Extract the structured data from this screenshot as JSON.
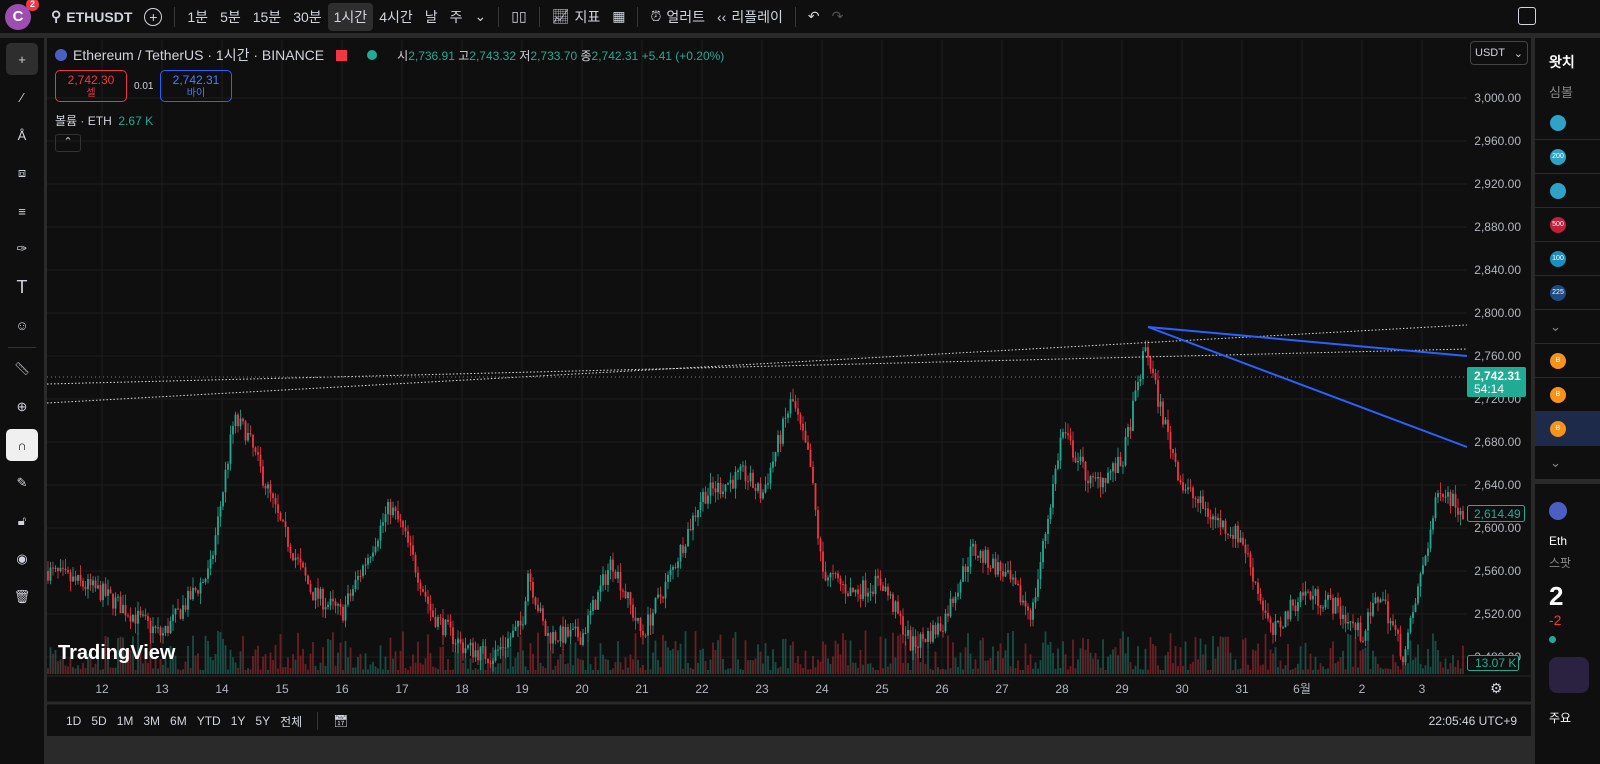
{
  "topbar": {
    "avatar_letter": "C",
    "notif_count": "2",
    "symbol": "ETHUSDT",
    "intervals": [
      "1분",
      "5분",
      "15분",
      "30분",
      "1시간",
      "4시간",
      "날",
      "주"
    ],
    "active_interval": "1시간",
    "indicators": "지표",
    "alert": "얼러트",
    "replay": "리플레이"
  },
  "legend": {
    "title": "Ethereum / TetherUS · 1시간 · BINANCE",
    "o_label": "시",
    "o": "2,736.91",
    "h_label": "고",
    "h": "2,743.32",
    "l_label": "저",
    "l": "2,733.70",
    "c_label": "종",
    "c": "2,742.31",
    "change": "+5.41 (+0.20%)"
  },
  "trade": {
    "sell_price": "2,742.30",
    "sell_label": "셀",
    "spread": "0.01",
    "buy_price": "2,742.31",
    "buy_label": "바이"
  },
  "volume": {
    "label": "볼륨 · ETH",
    "value": "2.67 K"
  },
  "currency": "USDT",
  "price_axis": {
    "ticks": [
      "3,000.00",
      "2,960.00",
      "2,920.00",
      "2,880.00",
      "2,840.00",
      "2,800.00",
      "2,760.00",
      "2,720.00",
      "2,680.00",
      "2,640.00",
      "2,600.00",
      "2,560.00",
      "2,520.00",
      "2,480.00"
    ],
    "last_price": "2,742.31",
    "countdown": "54:14",
    "marker_price": "2,614.49",
    "volume_marker": "13.07 K"
  },
  "time_axis": [
    "12",
    "13",
    "14",
    "15",
    "16",
    "17",
    "18",
    "19",
    "20",
    "21",
    "22",
    "23",
    "24",
    "25",
    "26",
    "27",
    "28",
    "29",
    "30",
    "31",
    "6월",
    "2",
    "3"
  ],
  "watermark": "TradingView",
  "bottombar": {
    "ranges": [
      "1D",
      "5D",
      "1M",
      "3M",
      "6M",
      "YTD",
      "1Y",
      "5Y",
      "전체"
    ],
    "time": "22:05:46 UTC+9"
  },
  "rightpanel": {
    "header": "왓치",
    "symbol_col": "심볼",
    "coins": [
      "",
      "200",
      "",
      "500",
      "100",
      "225"
    ],
    "detail_name": "Eth",
    "detail_type": "스팟",
    "detail_price": "2",
    "detail_change": "-2",
    "footer": "주요"
  },
  "colors": {
    "up": "#22ab94",
    "down": "#f23645",
    "trend": "#2962ff",
    "bg": "#0f0f0f"
  },
  "chart_data": {
    "type": "candlestick",
    "symbol": "ETHUSDT",
    "interval": "1h",
    "ylim": [
      2470,
      3010
    ],
    "path": [
      [
        11.1,
        2560
      ],
      [
        12,
        2540
      ],
      [
        13,
        2500
      ],
      [
        13.8,
        2560
      ],
      [
        14.2,
        2700
      ],
      [
        14.4,
        2690
      ],
      [
        15,
        2600
      ],
      [
        15.5,
        2540
      ],
      [
        16,
        2520
      ],
      [
        16.8,
        2620
      ],
      [
        17,
        2600
      ],
      [
        17.5,
        2520
      ],
      [
        18,
        2490
      ],
      [
        18.5,
        2480
      ],
      [
        19,
        2510
      ],
      [
        19.1,
        2560
      ],
      [
        19.4,
        2500
      ],
      [
        20,
        2500
      ],
      [
        20.5,
        2570
      ],
      [
        21,
        2500
      ],
      [
        21.5,
        2560
      ],
      [
        22,
        2630
      ],
      [
        22.7,
        2650
      ],
      [
        23,
        2630
      ],
      [
        23.5,
        2720
      ],
      [
        23.8,
        2660
      ],
      [
        24,
        2560
      ],
      [
        24.5,
        2540
      ],
      [
        25,
        2550
      ],
      [
        25.5,
        2490
      ],
      [
        26,
        2510
      ],
      [
        26.5,
        2580
      ],
      [
        27,
        2560
      ],
      [
        27.5,
        2520
      ],
      [
        28,
        2690
      ],
      [
        28.5,
        2640
      ],
      [
        29,
        2660
      ],
      [
        29.4,
        2770
      ],
      [
        29.6,
        2720
      ],
      [
        30,
        2640
      ],
      [
        30.5,
        2610
      ],
      [
        31,
        2590
      ],
      [
        31.5,
        2500
      ],
      [
        32,
        2540
      ],
      [
        32.5,
        2530
      ],
      [
        33,
        2500
      ],
      [
        33.3,
        2540
      ],
      [
        33.7,
        2480
      ],
      [
        34,
        2560
      ],
      [
        34.3,
        2640
      ],
      [
        34.7,
        2614
      ]
    ]
  }
}
